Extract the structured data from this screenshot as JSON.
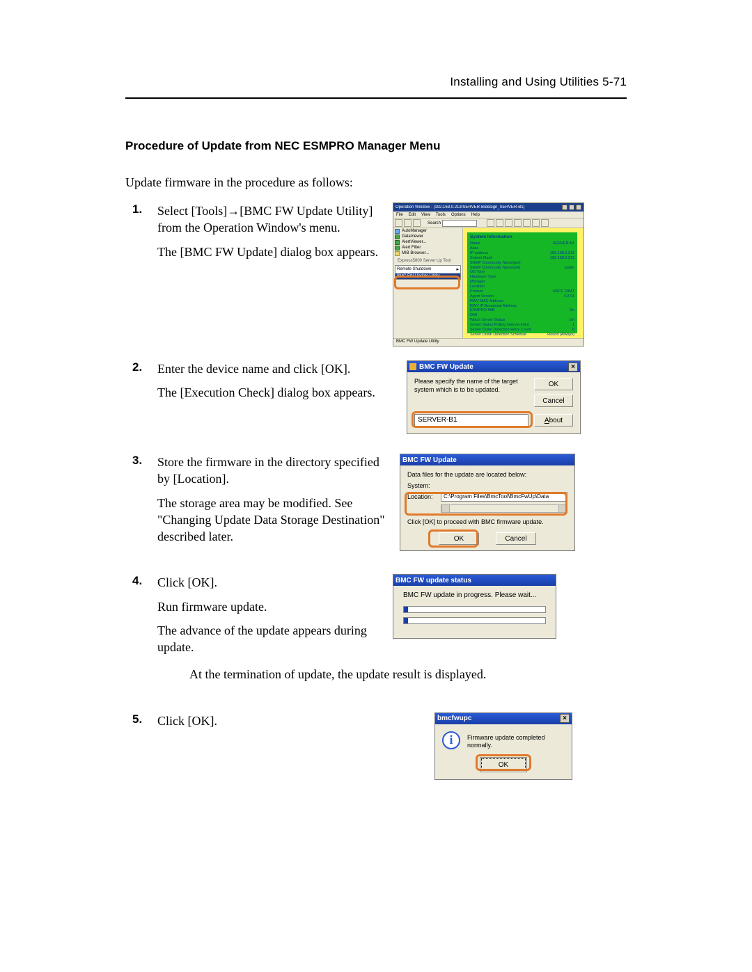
{
  "header": {
    "running_head": "Installing and Using Utilities    5-71"
  },
  "section_title": "Procedure of Update from NEC ESMPRO Manager Menu",
  "intro": "Update firmware in the procedure as follows:",
  "steps": {
    "s1": {
      "p1_a": "Select [Tools]",
      "arrow": "→",
      "p1_b": "[BMC FW Update Utility] from the Operation Window's menu.",
      "p2": "The [BMC FW Update] dialog box appears."
    },
    "s2": {
      "p1": "Enter the device name and click [OK].",
      "p2": "The [Execution Check] dialog box appears."
    },
    "s3": {
      "p1": "Store the firmware in the directory specified by [Location].",
      "p2": "The storage area may be modified. See \"Changing Update Data Storage Destination\" described later."
    },
    "s4": {
      "p1": "Click [OK].",
      "p2": "Run firmware update.",
      "p3": "The advance of the update appears during update.",
      "p4": "At the termination of update, the update result is displayed."
    },
    "s5": {
      "p1": "Click [OK]."
    }
  },
  "fig1": {
    "title": "Operation Window - [192.168.0.213/SERVER-B/design_SERVER-B1]",
    "menubar": [
      "File",
      "Edit",
      "View",
      "Tools",
      "Options",
      "Help"
    ],
    "toolbar_search_label": "Search",
    "tree": {
      "items": [
        "DataViewer",
        "AlertViewer...",
        "Alert Filter",
        "MIB Browser..."
      ],
      "group": "Express5800 Server Up Tool",
      "dropdown_header": "Remote Shutdown",
      "dropdown_item": "BMC FW Update Utility"
    },
    "info_header": "System Information",
    "info_rows": [
      {
        "k": "Name",
        "v": "SERVER-B1"
      },
      {
        "k": "Alias",
        "v": ""
      },
      {
        "k": "IP address",
        "v": "192.168.0.213"
      },
      {
        "k": "Subnet Mask",
        "v": "192.168.0.213"
      },
      {
        "k": "SNMP Community Name(get)",
        "v": ""
      },
      {
        "k": "SNMP Community Name(set)",
        "v": "public"
      },
      {
        "k": "OS Type",
        "v": ""
      },
      {
        "k": "Hardware Type",
        "v": ""
      },
      {
        "k": "Manager",
        "v": ""
      },
      {
        "k": "Location",
        "v": ""
      },
      {
        "k": "Product",
        "v": "NSCC 20MT"
      },
      {
        "k": "Agent Version",
        "v": "4.2.01"
      },
      {
        "k": "RWV MAC Address",
        "v": ""
      },
      {
        "k": "RWV IP Broadcast Address",
        "v": ""
      },
      {
        "k": "ESMPRO MIB",
        "v": "On"
      },
      {
        "k": "DMI",
        "v": ""
      },
      {
        "k": "Watch Server Status",
        "v": "On"
      },
      {
        "k": "Server Status Polling Interval (min)",
        "v": "1"
      },
      {
        "k": "Server Down Detection Retry Count",
        "v": "0"
      },
      {
        "k": "Server Down Detection Schedule",
        "v": "Round (Always)"
      }
    ],
    "status": "BMC FW Update Utility"
  },
  "fig2": {
    "title": "BMC FW Update",
    "msg": "Please specify the name of the target system which is to be updated.",
    "btn_ok": "OK",
    "btn_cancel": "Cancel",
    "btn_about": "About",
    "input_value": "SERVER-B1"
  },
  "fig3": {
    "title": "BMC FW Update",
    "lbl": "Data files for the update are located below:",
    "system_label": "System:",
    "location_label": "Location:",
    "location_value": "C:\\Program Files\\BmcTool\\BmcFwUp\\Data",
    "note": "Click [OK] to proceed with BMC firmware update.",
    "btn_ok": "OK",
    "btn_cancel": "Cancel"
  },
  "fig4": {
    "title": "BMC FW update status",
    "msg": "BMC FW update in progress. Please wait..."
  },
  "fig5": {
    "title": "bmcfwupc",
    "msg": "Firmware update completed normally.",
    "btn_ok": "OK",
    "info_glyph": "i"
  }
}
